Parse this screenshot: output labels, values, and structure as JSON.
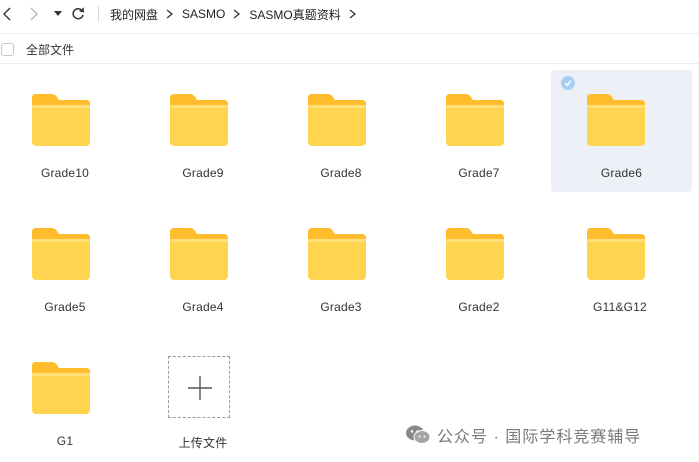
{
  "breadcrumb": [
    "我的网盘",
    "SASMO",
    "SASMO真题资料"
  ],
  "select_all_label": "全部文件",
  "folders": [
    "Grade10",
    "Grade9",
    "Grade8",
    "Grade7",
    "Grade6",
    "Grade5",
    "Grade4",
    "Grade3",
    "Grade2",
    "G11&G12",
    "G1"
  ],
  "selected_folder": "Grade6",
  "upload_label": "上传文件",
  "watermark": "公众号 · 国际学科竞赛辅导",
  "colors": {
    "folder_body": "#FFD54F",
    "folder_back": "#FFBC2C",
    "selection_bg": "#eef0f8",
    "check": "#a9cdf3"
  }
}
